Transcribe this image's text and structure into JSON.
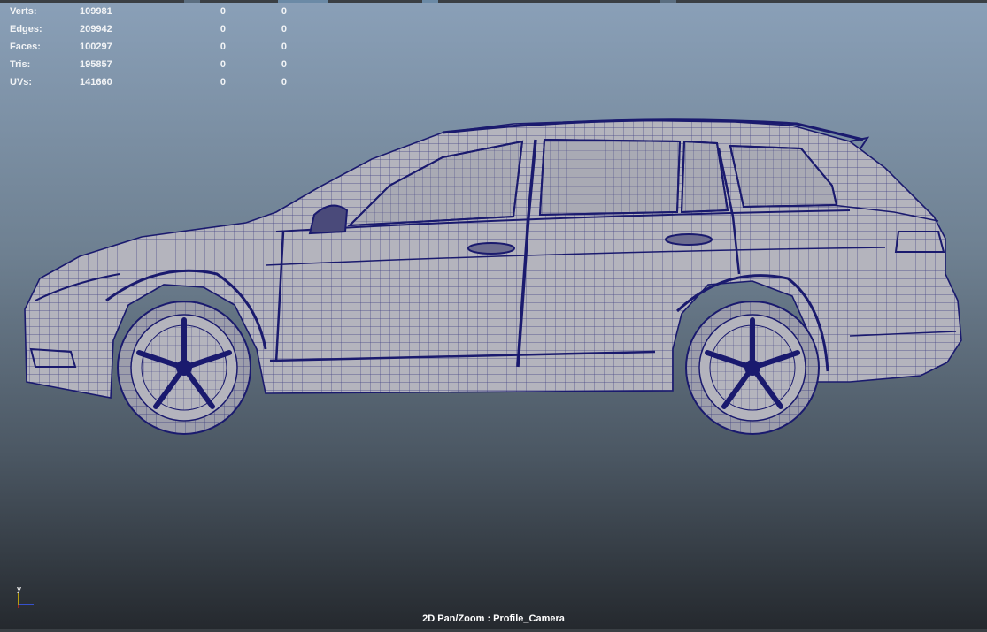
{
  "hud": {
    "rows": [
      {
        "label": "Verts:",
        "total": "109981",
        "selected": "0",
        "component": "0"
      },
      {
        "label": "Edges:",
        "total": "209942",
        "selected": "0",
        "component": "0"
      },
      {
        "label": "Faces:",
        "total": "100297",
        "selected": "0",
        "component": "0"
      },
      {
        "label": "Tris:",
        "total": "195857",
        "selected": "0",
        "component": "0"
      },
      {
        "label": "UVs:",
        "total": "141660",
        "selected": "0",
        "component": "0"
      }
    ]
  },
  "viewport": {
    "camera_label": "2D Pan/Zoom : Profile_Camera",
    "axis_label": "y",
    "wire_color": "#1a1a6e",
    "body_color": "#b4b4bd"
  }
}
